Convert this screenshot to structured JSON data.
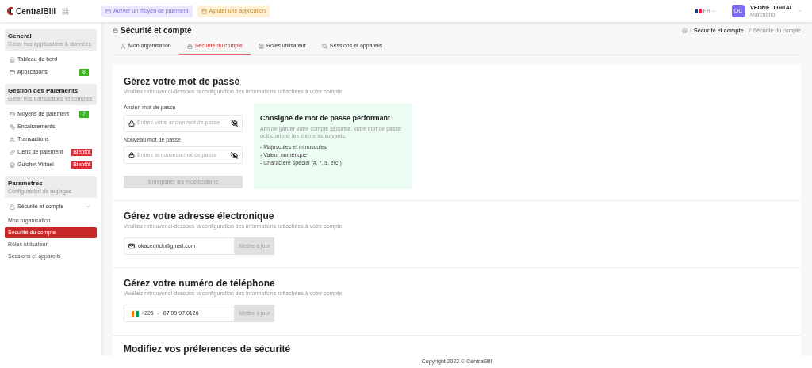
{
  "header": {
    "logo_text": "CentralBill",
    "quick_actions": [
      {
        "label": "Activer un moyen de paiement",
        "kind": "payment"
      },
      {
        "label": "Ajouter une application",
        "kind": "app"
      }
    ],
    "language": "FR",
    "user": {
      "initials": "OC",
      "name": "VEONE DIGITAL",
      "role": "Marchand"
    }
  },
  "sidebar": {
    "sections": [
      {
        "title": "General",
        "subtitle": "Gérer vos applications & données",
        "items": [
          {
            "label": "Tableau de bord",
            "kind": "home"
          },
          {
            "label": "Applications",
            "kind": "apps",
            "badge": {
              "text": "8",
              "kind": "count"
            }
          }
        ]
      },
      {
        "title": "Gestion des Paiements",
        "subtitle": "Gérer vos transactions et comptes",
        "items": [
          {
            "label": "Moyens de paiement",
            "kind": "card",
            "badge": {
              "text": "7",
              "kind": "count"
            }
          },
          {
            "label": "Encaissements",
            "kind": "coins"
          },
          {
            "label": "Transactions",
            "kind": "users"
          },
          {
            "label": "Liens de paiement",
            "kind": "link",
            "badge": {
              "text": "Bientôt",
              "kind": "new"
            }
          },
          {
            "label": "Guichet Virtuel",
            "kind": "store",
            "badge": {
              "text": "Bientôt",
              "kind": "new"
            }
          }
        ]
      },
      {
        "title": "Paramètres",
        "subtitle": "Configuration de réglages",
        "items": [
          {
            "label": "Sécurité et compte",
            "kind": "lock",
            "expanded": true,
            "children": [
              {
                "label": "Mon organisation",
                "selected": false
              },
              {
                "label": "Sécurité du compte",
                "selected": true
              },
              {
                "label": "Rôles utilisateur",
                "selected": false
              },
              {
                "label": "Sessions et appareils",
                "selected": false
              }
            ]
          }
        ]
      }
    ]
  },
  "page": {
    "title": "Sécurité et compte",
    "breadcrumb_separator": "/",
    "breadcrumb": [
      "Sécurité et compte",
      "Sécurité du compte"
    ],
    "tabs": [
      {
        "label": "Mon organisation",
        "kind": "user",
        "selected": false
      },
      {
        "label": "Sécurité du compte",
        "kind": "lock",
        "selected": true
      },
      {
        "label": "Rôles utilisateur",
        "kind": "badge",
        "selected": false
      },
      {
        "label": "Sessions et appareils",
        "kind": "devices",
        "selected": false
      }
    ],
    "sections": [
      {
        "kind": "password",
        "title": "Gérez votre mot de passe",
        "subtitle": "Veuillez retrouver ci-dessous la configuration des informations rattachées à votre compte",
        "fields": [
          {
            "label": "Ancien mot de passe",
            "placeholder": "Entrez votre ancien mot de passe"
          },
          {
            "label": "Nouveau mot de passe",
            "placeholder": "Entrez le nouveau mot de passe"
          }
        ],
        "button": {
          "label": "Enregistrer les modifications",
          "disabled": true
        },
        "tip": {
          "title": "Consigne de mot de passe performant",
          "text": "Afin de garder votre compte sécurisé, votre mot de passe doit contenir les éléments suivants:",
          "items": [
            "- Majuscules et minuscules",
            "- Valeur numérique",
            "- Charactère spécial (#, *, $, etc.)"
          ]
        }
      },
      {
        "kind": "email",
        "title": "Gérez votre adresse électronique",
        "subtitle": "Veuillez retrouver ci-dessous la configuration des informations rattachées à votre compte",
        "value": "okacedrick@gmail.com",
        "button": {
          "label": "Mettre à jour",
          "disabled": true
        }
      },
      {
        "kind": "phone",
        "title": "Gérez votre numéro de téléphone",
        "subtitle": "Veuillez retrouver ci-dessous la configuration des informations rattachées à votre compte",
        "code": "+225",
        "value": "07 09 97 0126",
        "button": {
          "label": "Mettre à jour",
          "disabled": true
        }
      },
      {
        "kind": "preferences",
        "title": "Modifiez vos préferences de sécurité"
      }
    ]
  },
  "footer": "Copyright 2022 © CentralBill"
}
